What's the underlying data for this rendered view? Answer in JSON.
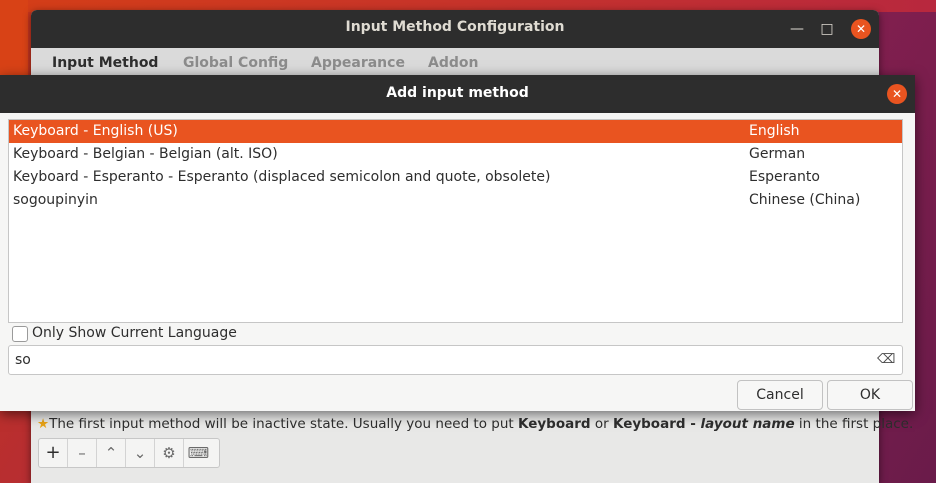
{
  "background_window": {
    "title": "Input Method Configuration",
    "tabs": [
      "Input Method",
      "Global Config",
      "Appearance",
      "Addon"
    ],
    "hint": {
      "part1": "The first input method will be inactive state. Usually you need to put ",
      "bold1": "Keyboard",
      "part2": " or ",
      "bold2": "Keyboard - ",
      "italic": "layout name",
      "part3": " in the first place."
    },
    "toolbar_icons": [
      "add-icon",
      "remove-icon",
      "move-up-icon",
      "move-down-icon",
      "configure-icon",
      "keyboard-layout-icon"
    ]
  },
  "dialog": {
    "title": "Add input method",
    "items": [
      {
        "name": "Keyboard - English (US)",
        "language": "English",
        "selected": true
      },
      {
        "name": "Keyboard - Belgian - Belgian (alt. ISO)",
        "language": "German",
        "selected": false
      },
      {
        "name": "Keyboard - Esperanto - Esperanto (displaced semicolon and quote, obsolete)",
        "language": "Esperanto",
        "selected": false
      },
      {
        "name": "sogoupinyin",
        "language": "Chinese (China)",
        "selected": false
      }
    ],
    "only_current_language_label": "Only Show Current Language",
    "only_current_language_checked": false,
    "search_value": "so",
    "cancel_label": "Cancel",
    "ok_label": "OK"
  },
  "colors": {
    "accent": "#e95420",
    "titlebar": "#2d2d2d"
  }
}
